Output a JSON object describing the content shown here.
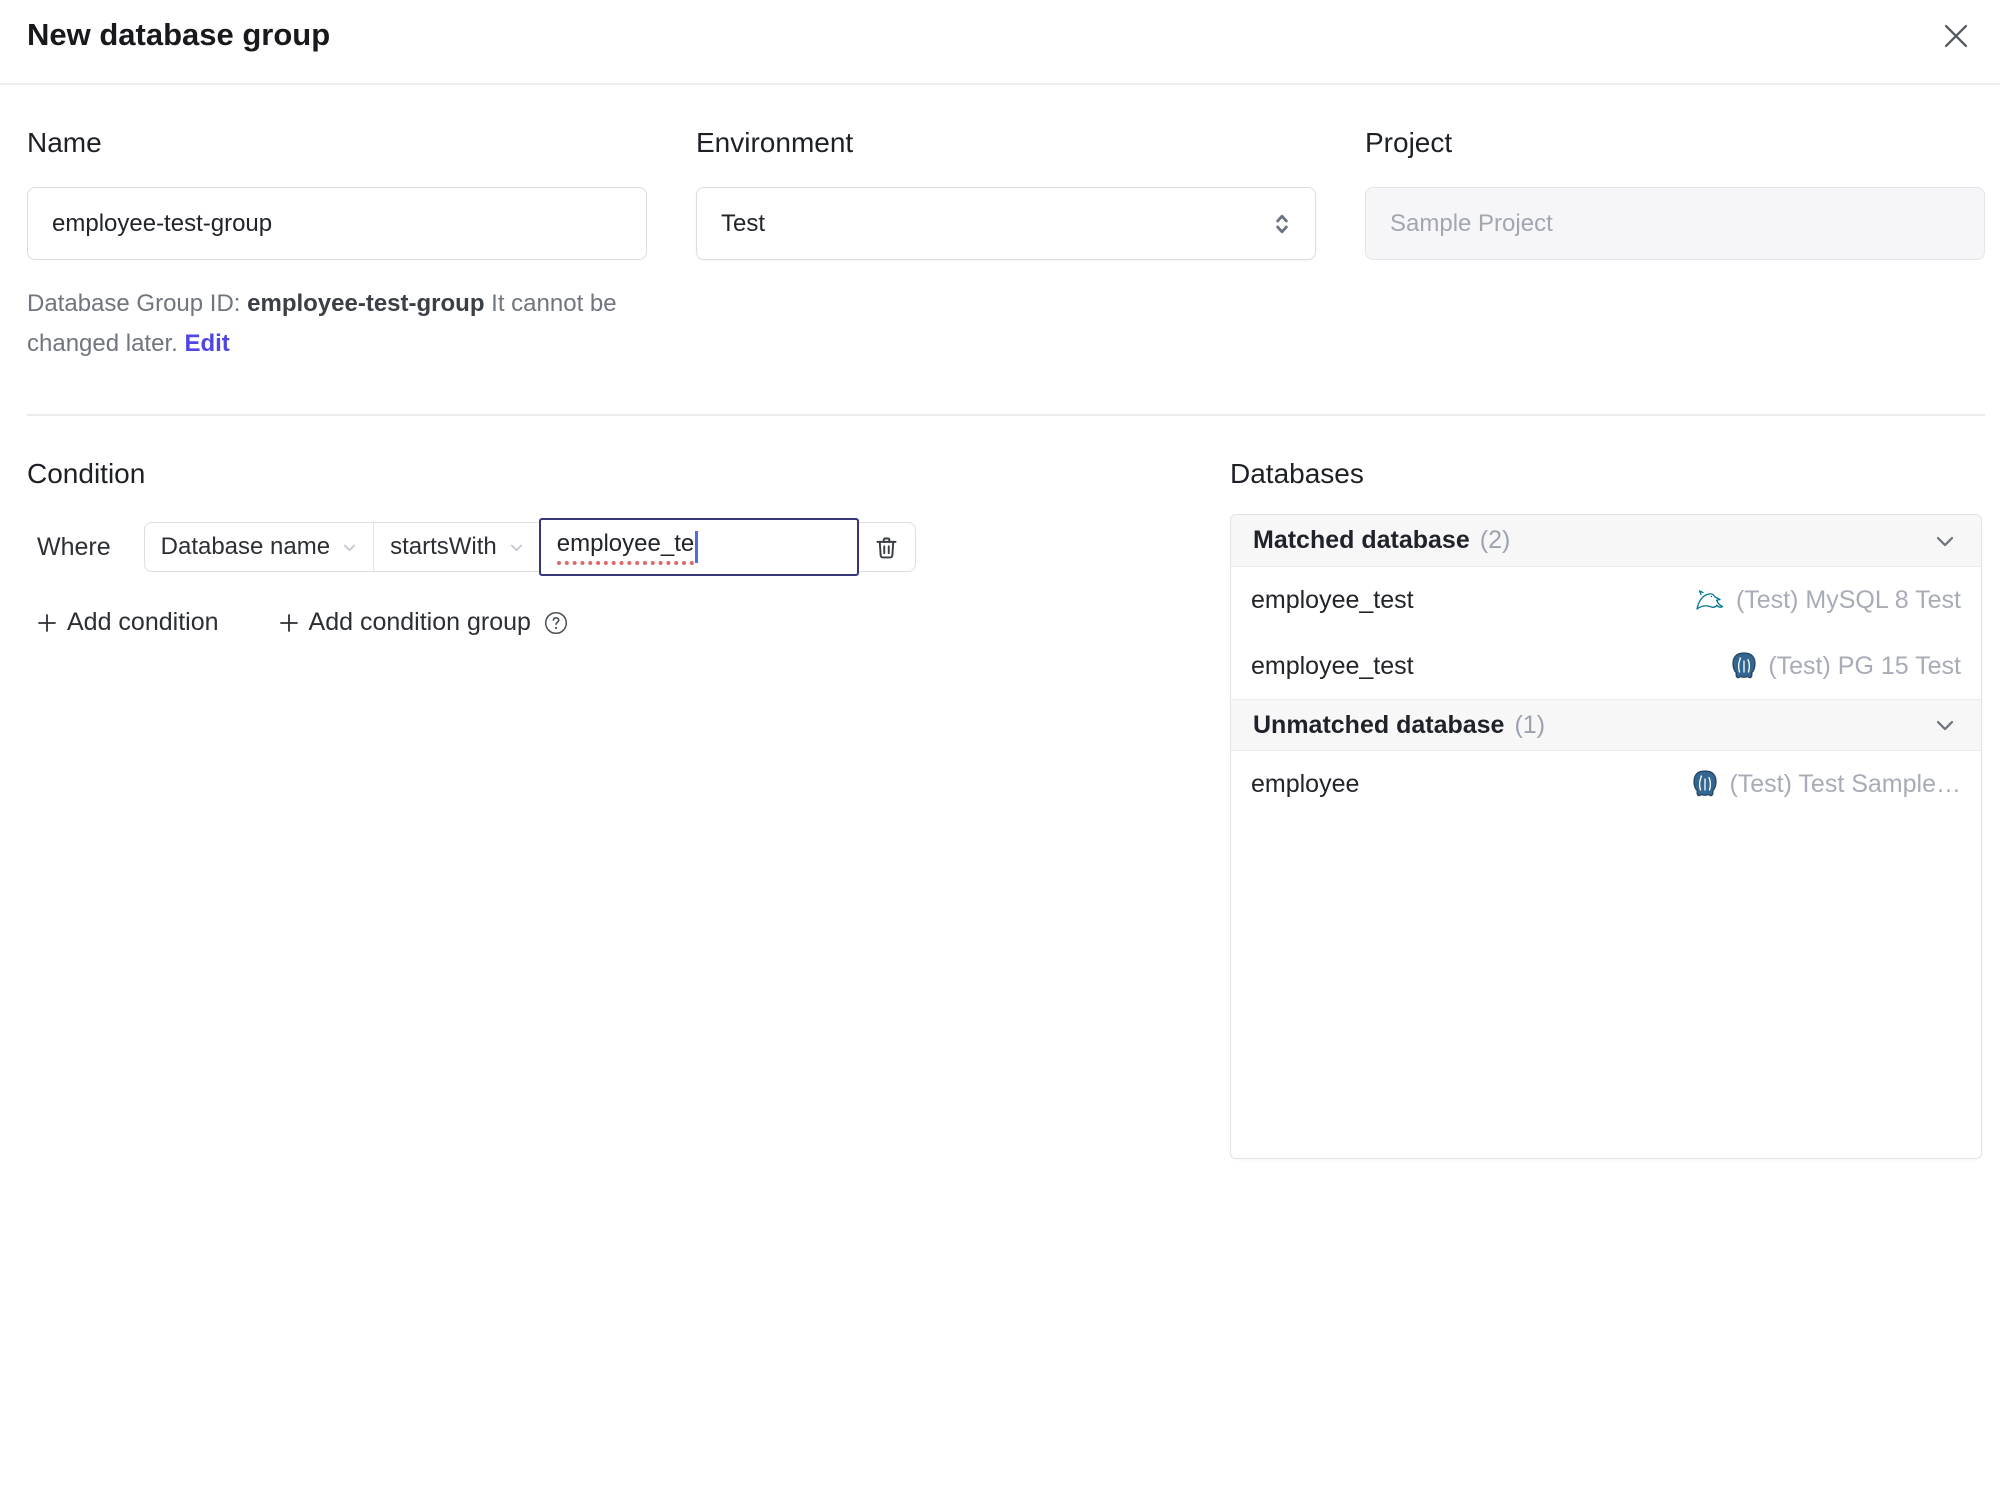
{
  "dialog": {
    "title": "New database group",
    "close_icon": "x-icon"
  },
  "form": {
    "name": {
      "label": "Name",
      "value": "employee-test-group"
    },
    "environment": {
      "label": "Environment",
      "value": "Test"
    },
    "project": {
      "label": "Project",
      "value": "Sample Project"
    },
    "id_help": {
      "prefix": "Database Group ID: ",
      "id": "employee-test-group",
      "suffix": " It cannot be changed later. ",
      "edit_label": "Edit"
    }
  },
  "condition": {
    "heading": "Condition",
    "where_label": "Where",
    "factor": "Database name",
    "operator": "startsWith",
    "value": "employee_te",
    "add_condition_label": "Add condition",
    "add_condition_group_label": "Add condition group"
  },
  "databases": {
    "heading": "Databases",
    "groups": [
      {
        "title": "Matched database",
        "count": "(2)",
        "rows": [
          {
            "name": "employee_test",
            "engine": "mysql",
            "instance": "(Test) MySQL 8 Test"
          },
          {
            "name": "employee_test",
            "engine": "postgresql",
            "instance": "(Test) PG 15 Test"
          }
        ]
      },
      {
        "title": "Unmatched database",
        "count": "(1)",
        "rows": [
          {
            "name": "employee",
            "engine": "postgresql",
            "instance": "(Test) Test Sample…"
          }
        ]
      }
    ]
  },
  "colors": {
    "accent_link": "#4f46e5",
    "focused_input_border": "#38367d",
    "spellcheck_underline": "#dd6a6a",
    "mysql_icon": "#00758f",
    "postgresql_icon": "#336791",
    "muted_text": "#9ca3af",
    "divider": "#ebebed"
  }
}
